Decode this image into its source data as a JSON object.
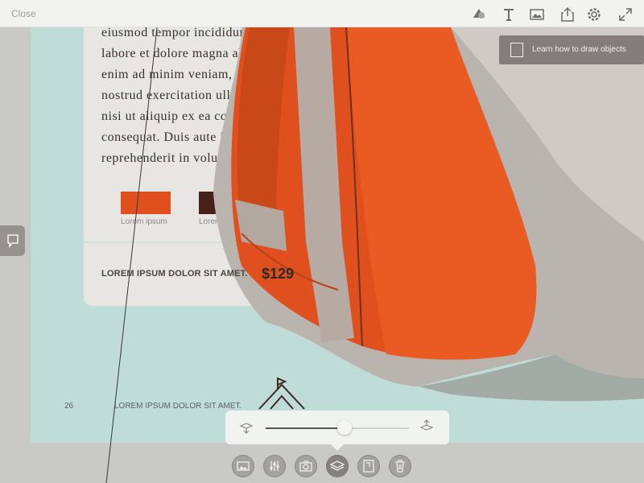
{
  "topbar": {
    "close_label": "Close",
    "icons": [
      "shape-icon",
      "text-icon",
      "image-icon",
      "share-icon",
      "settings-icon",
      "fullscreen-icon"
    ]
  },
  "tooltip": {
    "text": "Learn how to draw objects"
  },
  "artboard": {
    "body_lines": [
      "eiusmod tempor incididunt ut",
      "labore et dolore magna aliqua. Ut",
      "enim ad minim veniam, quis",
      "nostrud exercitation ullamco laboris",
      "nisi ut aliquip ex ea commodo",
      "consequat. Duis aute irure dolor in",
      "reprehenderit in voluptate velit esse"
    ],
    "swatches": [
      {
        "color": "#e0501e",
        "label": "Lorem ipsum"
      },
      {
        "color": "#47201a",
        "label": "Lorem ipsum"
      },
      {
        "color": "#a9a49f",
        "label": ""
      }
    ],
    "product_name": "LOREM IPSUM DOLOR SIT AMET.",
    "price": "$129",
    "page_number": "26",
    "footer_text": "LOREM IPSUM DOLOR SIT AMET."
  },
  "depth_slider": {
    "value_fraction": 0.55
  },
  "bottom_toolbar": {
    "icons": [
      "photo-icon",
      "adjust-icon",
      "camera-icon",
      "layers-icon",
      "crop-icon",
      "trash-icon"
    ]
  },
  "colors": {
    "artboard_bg": "#bfdcd6",
    "bag_orange": "#e0501e",
    "bag_gray": "#b9b4ae",
    "bag_brown": "#47201a"
  }
}
